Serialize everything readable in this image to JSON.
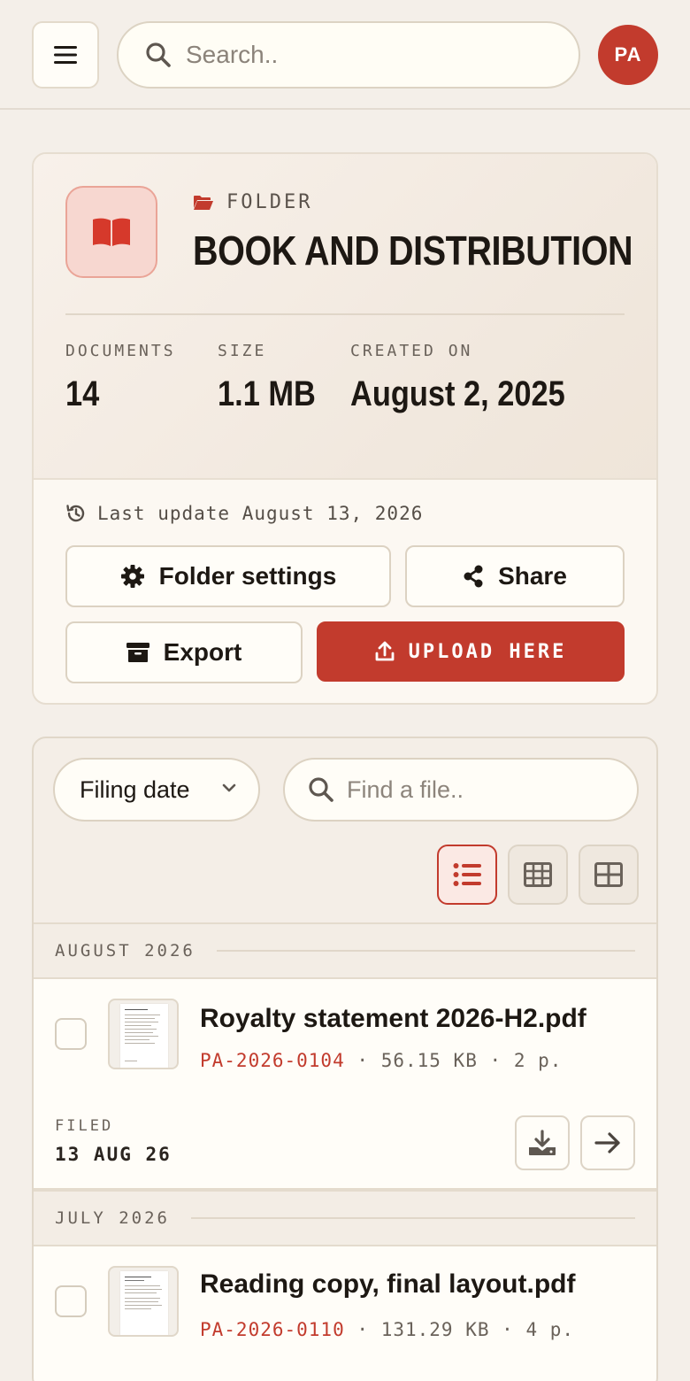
{
  "header": {
    "search_placeholder": "Search..",
    "avatar_initials": "PA"
  },
  "folder": {
    "kicker": "FOLDER",
    "title": "BOOK AND DISTRIBUTION",
    "stats": [
      {
        "label": "DOCUMENTS",
        "value": "14"
      },
      {
        "label": "SIZE",
        "value": "1.1 MB"
      },
      {
        "label": "CREATED ON",
        "value": "August 2, 2025"
      }
    ],
    "last_update": "Last update August 13, 2026",
    "actions": {
      "settings": "Folder settings",
      "share": "Share",
      "export": "Export",
      "upload": "UPLOAD HERE"
    }
  },
  "files": {
    "sort_selected": "Filing date",
    "find_placeholder": "Find a file..",
    "views": [
      "list",
      "compact-grid",
      "grid"
    ],
    "active_view": "list",
    "groups": [
      {
        "label": "AUGUST 2026",
        "items": [
          {
            "name": "Royalty statement 2026-H2.pdf",
            "ref": "PA-2026-0104",
            "size": "56.15 KB",
            "pages": "2 p.",
            "filed_label": "FILED",
            "filed_date": "13 AUG 26"
          }
        ]
      },
      {
        "label": "JULY 2026",
        "items": [
          {
            "name": "Reading copy, final layout.pdf",
            "ref": "PA-2026-0110",
            "size": "131.29 KB",
            "pages": "4 p."
          }
        ]
      }
    ]
  },
  "colors": {
    "accent": "#c23b2d",
    "background": "#f4efe9",
    "card": "#fffdf8"
  },
  "separator": "·"
}
